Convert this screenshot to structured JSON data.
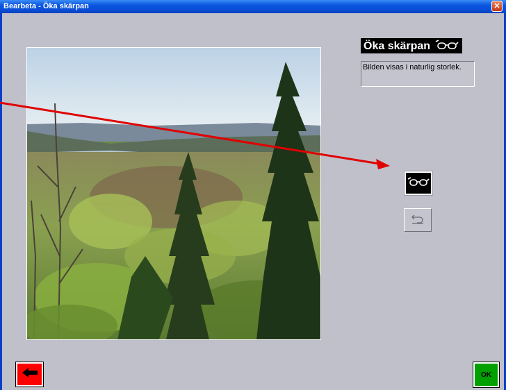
{
  "window": {
    "title": "Bearbeta - Öka skärpan",
    "close_label": "✕"
  },
  "panel": {
    "title": "Öka skärpan",
    "info": "Bilden visas i naturlig storlek."
  },
  "buttons": {
    "ok_label": "OK"
  },
  "icons": {
    "panel_title_icon": "glasses-icon",
    "sharpen_icon": "glasses-icon",
    "undo_icon": "undo-icon",
    "back_icon": "arrow-left-icon"
  },
  "colors": {
    "titlebar": "#0a56e0",
    "window_bg": "#c0c0cb",
    "back_button": "#ff0000",
    "ok_button": "#00a000",
    "annotation_arrow": "#e00000"
  }
}
